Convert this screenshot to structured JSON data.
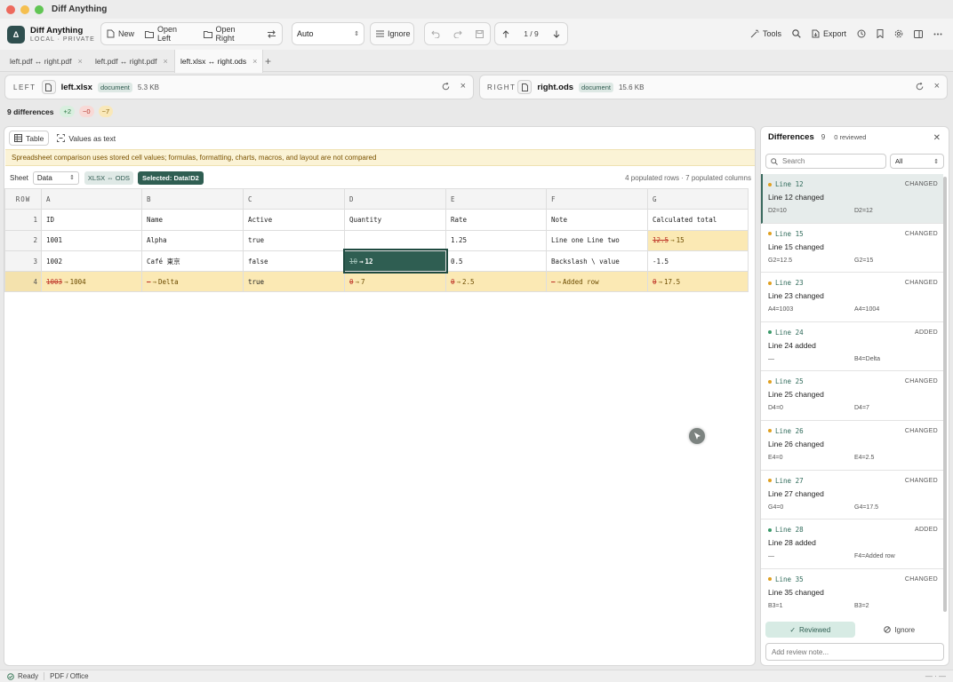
{
  "window": {
    "title": "Diff Anything"
  },
  "brand": {
    "logo": "Δ",
    "name": "Diff Anything",
    "subtitle": "LOCAL · PRIVATE"
  },
  "toolbar": {
    "new_label": "New",
    "open_left_label": "Open Left",
    "open_right_label": "Open Right",
    "mode_value": "Auto",
    "ignore_label": "Ignore",
    "nav_position": "1 / 9",
    "tools_label": "Tools",
    "export_label": "Export"
  },
  "tabs": [
    {
      "label": "left.pdf ↔ right.pdf",
      "active": false
    },
    {
      "label": "left.pdf ↔ right.pdf",
      "active": false
    },
    {
      "label": "left.xlsx ↔ right.ods",
      "active": true
    }
  ],
  "left_file": {
    "side": "LEFT",
    "name": "left.xlsx",
    "kind": "document",
    "size": "5.3 KB"
  },
  "right_file": {
    "side": "RIGHT",
    "name": "right.ods",
    "kind": "document",
    "size": "15.6 KB"
  },
  "summary": {
    "text": "9 differences",
    "added": "+2",
    "removed": "−0",
    "changed": "~7"
  },
  "view": {
    "tabs": [
      "Table",
      "Values as text"
    ],
    "banner": "Spreadsheet comparison uses stored cell values; formulas, formatting, charts, macros, and layout are not compared",
    "sheet_label": "Sheet",
    "sheet_value": "Data",
    "format_chip": "XLSX ⇔ ODS",
    "selected_chip": "Selected: Data!D2",
    "populated": "4 populated rows · 7 populated columns"
  },
  "grid": {
    "row_header": "ROW",
    "columns": [
      "A",
      "B",
      "C",
      "D",
      "E",
      "F",
      "G"
    ],
    "rows": [
      {
        "num": "1",
        "cells": [
          {
            "v": "ID"
          },
          {
            "v": "Name"
          },
          {
            "v": "Active"
          },
          {
            "v": "Quantity"
          },
          {
            "v": "Rate"
          },
          {
            "v": "Note"
          },
          {
            "v": "Calculated total"
          }
        ]
      },
      {
        "num": "2",
        "cells": [
          {
            "v": "1001"
          },
          {
            "v": "Alpha"
          },
          {
            "v": "true"
          },
          {
            "v": ""
          },
          {
            "v": "1.25"
          },
          {
            "v": "Line one Line two"
          },
          {
            "old": "12.5",
            "new": "15",
            "changed": true
          }
        ]
      },
      {
        "num": "3",
        "cells": [
          {
            "v": "1002"
          },
          {
            "v": "Café 東京"
          },
          {
            "v": "false"
          },
          {
            "old": "10",
            "new": "12",
            "changed": true,
            "selected": true
          },
          {
            "v": "0.5"
          },
          {
            "v": "Backslash \\ value"
          },
          {
            "v": "-1.5"
          }
        ]
      },
      {
        "num": "4",
        "added": true,
        "cells": [
          {
            "old": "1003",
            "new": "1004",
            "changed": true
          },
          {
            "old": "—",
            "new": "Delta",
            "changed": true
          },
          {
            "v": "true"
          },
          {
            "old": "0",
            "new": "7",
            "changed": true
          },
          {
            "old": "0",
            "new": "2.5",
            "changed": true
          },
          {
            "old": "—",
            "new": "Added row",
            "changed": true
          },
          {
            "old": "0",
            "new": "17.5",
            "changed": true
          }
        ]
      }
    ]
  },
  "differences": {
    "title": "Differences",
    "count": "9",
    "reviewed": "0 reviewed",
    "search_placeholder": "Search",
    "filter_value": "All",
    "items": [
      {
        "line": "Line 12",
        "kind": "CHANGED",
        "summary": "Line 12 changed",
        "left": "D2=10",
        "right": "D2=12",
        "selected": true
      },
      {
        "line": "Line 15",
        "kind": "CHANGED",
        "summary": "Line 15 changed",
        "left": "G2=12.5",
        "right": "G2=15"
      },
      {
        "line": "Line 23",
        "kind": "CHANGED",
        "summary": "Line 23 changed",
        "left": "A4=1003",
        "right": "A4=1004"
      },
      {
        "line": "Line 24",
        "kind": "ADDED",
        "summary": "Line 24 added",
        "left": "—",
        "right": "B4=Delta"
      },
      {
        "line": "Line 25",
        "kind": "CHANGED",
        "summary": "Line 25 changed",
        "left": "D4=0",
        "right": "D4=7"
      },
      {
        "line": "Line 26",
        "kind": "CHANGED",
        "summary": "Line 26 changed",
        "left": "E4=0",
        "right": "E4=2.5"
      },
      {
        "line": "Line 27",
        "kind": "CHANGED",
        "summary": "Line 27 changed",
        "left": "G4=0",
        "right": "G4=17.5"
      },
      {
        "line": "Line 28",
        "kind": "ADDED",
        "summary": "Line 28 added",
        "left": "—",
        "right": "F4=Added row"
      },
      {
        "line": "Line 35",
        "kind": "CHANGED",
        "summary": "Line 35 changed",
        "left": "B3=1",
        "right": "B3=2"
      }
    ],
    "reviewed_label": "Reviewed",
    "ignore_label": "Ignore",
    "note_placeholder": "Add review note..."
  },
  "status": {
    "ready": "Ready",
    "mode": "PDF / Office",
    "right": "— · —"
  },
  "colors": {
    "accent": "#2f5e52",
    "changed": "#fbe9b4",
    "added_dot": "#3a9a6a",
    "changed_dot": "#e0a020",
    "banner": "#fbf3d6"
  }
}
